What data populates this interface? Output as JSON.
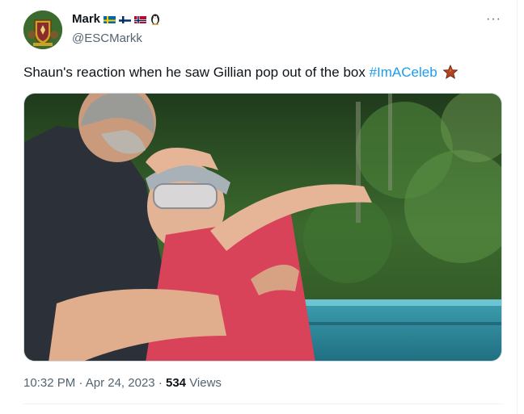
{
  "tweet": {
    "author": {
      "display_name": "Mark",
      "flags": [
        "Sweden",
        "Finland",
        "Norway"
      ],
      "extra_icon": "penguin-icon",
      "handle": "@ESCMarkk",
      "avatar_icon": "crest-avatar"
    },
    "more_label": "···",
    "text": "Shaun's reaction when he saw Gillian pop out of the box ",
    "hashtag": "#ImACeleb",
    "hashtag_icon": "star-emoji-icon",
    "media": {
      "type": "image",
      "description_icon": "photo"
    },
    "meta": {
      "time": "10:32 PM",
      "separator": "·",
      "date": "Apr 24, 2023",
      "views_count": "534",
      "views_label": "Views"
    }
  },
  "colors": {
    "text": "#0f1419",
    "secondary": "#536471",
    "link": "#1d9bf0",
    "border": "#cfd9de"
  }
}
